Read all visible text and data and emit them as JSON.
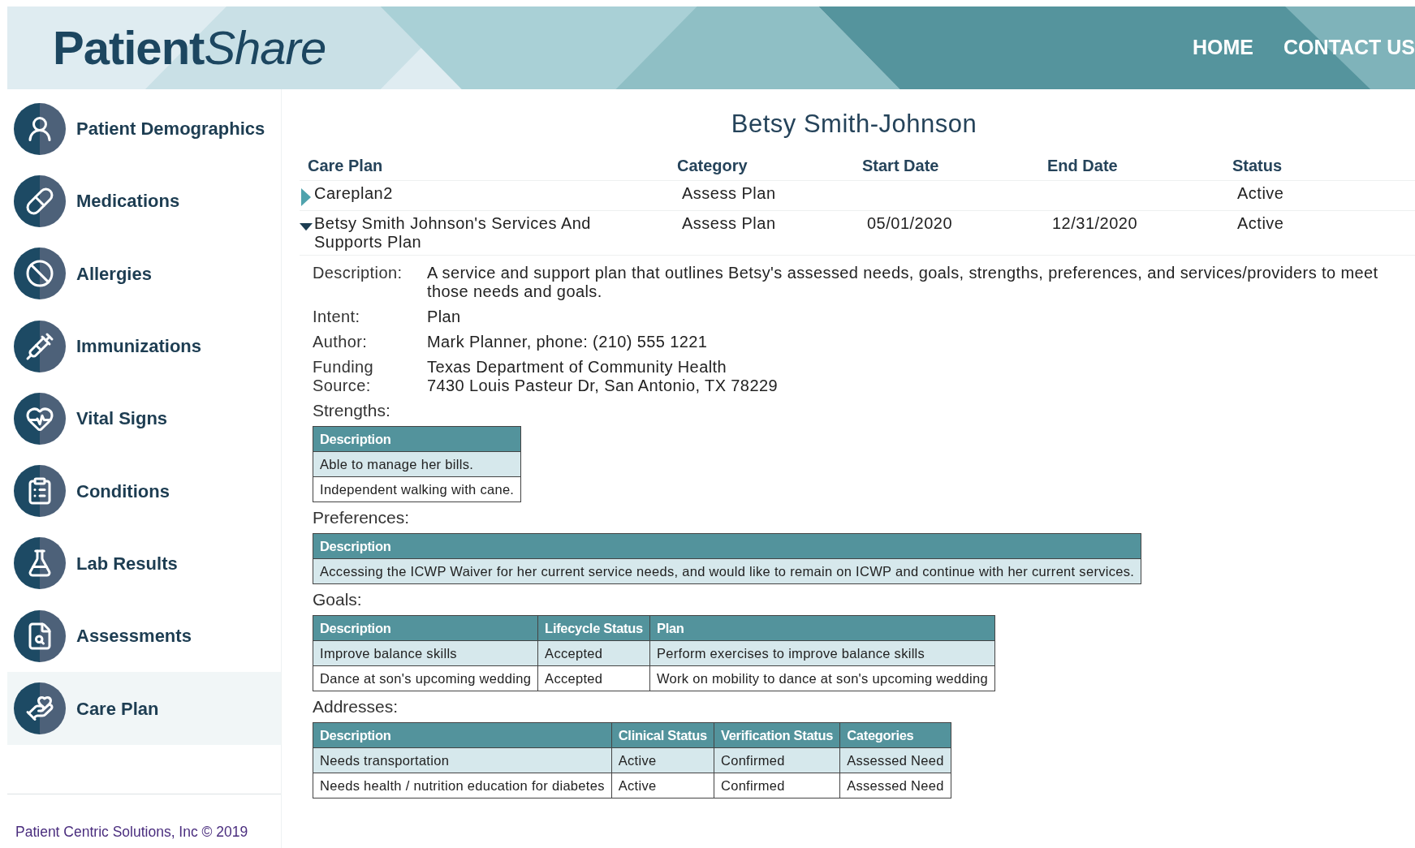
{
  "header": {
    "logo_bold": "Patient",
    "logo_italic": "Share",
    "nav": [
      {
        "label": "HOME"
      },
      {
        "label": "CONTACT US"
      }
    ]
  },
  "sidebar": {
    "items": [
      {
        "label": "Patient Demographics",
        "selected": false
      },
      {
        "label": "Medications",
        "selected": false
      },
      {
        "label": "Allergies",
        "selected": false
      },
      {
        "label": "Immunizations",
        "selected": false
      },
      {
        "label": "Vital Signs",
        "selected": false
      },
      {
        "label": "Conditions",
        "selected": false
      },
      {
        "label": "Lab Results",
        "selected": false
      },
      {
        "label": "Assessments",
        "selected": false
      },
      {
        "label": "Care Plan",
        "selected": true
      }
    ],
    "footer": "Patient Centric Solutions, Inc © 2019"
  },
  "patient_name": "Betsy Smith-Johnson",
  "care_plans": {
    "columns": [
      "Care Plan",
      "Category",
      "Start Date",
      "End Date",
      "Status"
    ],
    "rows": [
      {
        "expanded": false,
        "cells": [
          "Careplan2",
          "Assess Plan",
          "",
          "",
          "Active"
        ]
      },
      {
        "expanded": true,
        "cells": [
          "Betsy Smith Johnson's Services And Supports Plan",
          "Assess Plan",
          "05/01/2020",
          "12/31/2020",
          "Active"
        ]
      }
    ]
  },
  "details": [
    {
      "label": "Description:",
      "lines": [
        "A service and support plan that outlines Betsy's assessed needs, goals, strengths, preferences, and services/providers to meet those needs and goals."
      ]
    },
    {
      "label": "Intent:",
      "lines": [
        "Plan"
      ]
    },
    {
      "label": "Author:",
      "lines": [
        "Mark Planner, phone: (210) 555 1221"
      ]
    },
    {
      "label": "Funding Source:",
      "lines": [
        "Texas Department of Community Health",
        "7430 Louis Pasteur Dr, San Antonio, TX 78229"
      ]
    }
  ],
  "sections": [
    {
      "title": "Strengths:",
      "columns": [
        "Description"
      ],
      "rows": [
        [
          "Able to manage her bills."
        ],
        [
          "Independent walking with cane."
        ]
      ]
    },
    {
      "title": "Preferences:",
      "columns": [
        "Description"
      ],
      "rows": [
        [
          "Accessing the ICWP Waiver for her current service needs, and would like to remain on ICWP and continue with her current services."
        ]
      ]
    },
    {
      "title": "Goals:",
      "columns": [
        "Description",
        "Lifecycle Status",
        "Plan"
      ],
      "rows": [
        [
          "Improve balance skills",
          "Accepted",
          "Perform exercises to improve balance skills"
        ],
        [
          "Dance at son's upcoming wedding",
          "Accepted",
          "Work on mobility to dance at son's upcoming wedding"
        ]
      ]
    },
    {
      "title": "Addresses:",
      "columns": [
        "Description",
        "Clinical Status",
        "Verification Status",
        "Categories"
      ],
      "rows": [
        [
          "Needs transportation",
          "Active",
          "Confirmed",
          "Assessed Need"
        ],
        [
          "Needs health / nutrition education for diabetes",
          "Active",
          "Confirmed",
          "Assessed Need"
        ]
      ]
    }
  ]
}
